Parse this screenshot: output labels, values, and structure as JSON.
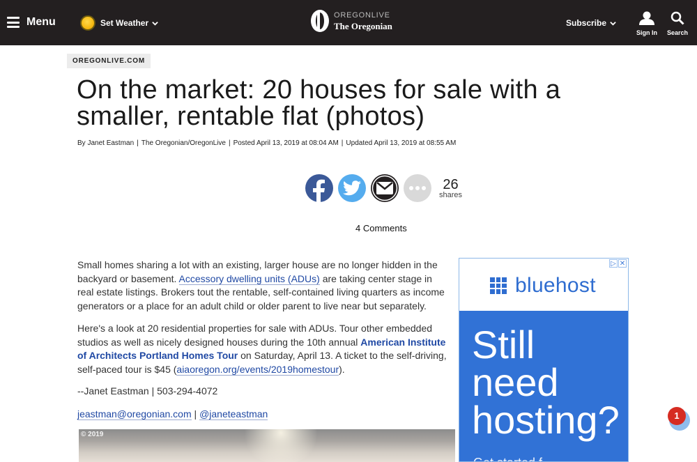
{
  "topbar": {
    "menu_label": "Menu",
    "weather_label": "Set Weather",
    "logo_top": "OREGONLIVE",
    "logo_bottom": "The Oregonian",
    "subscribe_label": "Subscribe",
    "signin_label": "Sign In",
    "search_label": "Search",
    "background_color": "#231f20"
  },
  "article": {
    "section_tag": "OREGONLIVE.COM",
    "headline": "On the market: 20 houses for sale with a smaller, rentable flat (photos)",
    "byline": {
      "prefix": "By",
      "author": "Janet Eastman",
      "publication": "The Oregonian/OregonLive",
      "posted": "Posted April 13, 2019 at 08:04 AM",
      "updated": "Updated April 13, 2019 at 08:55 AM"
    },
    "share": {
      "count": "26",
      "count_label": "shares"
    },
    "comments_label": "4 Comments",
    "paragraphs": {
      "p1_before": "Small homes sharing a lot with an existing, larger house are no longer hidden in the backyard or basement. ",
      "p1_link": "Accessory dwelling units (ADUs)",
      "p1_after": " are taking center stage in real estate listings. Brokers tout the rentable, self-contained living quarters as income generators or a place for an adult child or older parent to live near but separately.",
      "p2_before": "Here's a look at 20 residential properties for sale with ADUs. Tour other embedded studios as well as nicely designed houses during the 10th annual ",
      "p2_link": "American Institute of Architects Portland Homes Tour",
      "p2_middle": " on Saturday, April 13. A ticket to the self-driving, self-paced tour is $45 (",
      "p2_link2": "aiaoregon.org/events/2019homestour",
      "p2_after": ").",
      "p3": "--Janet Eastman | 503-294-4072",
      "p4_email": "jeastman@oregonian.com",
      "p4_sep": " | ",
      "p4_twitter": "@janeteastman"
    },
    "photo_credit": "© 2019",
    "link_color": "#2049a4"
  },
  "ad": {
    "brand": "bluehost",
    "headline": "Still need hosting?",
    "subline": "Get started f...",
    "choices_play": "▷",
    "choices_close": "✕",
    "brand_color": "#3172d6"
  },
  "notification": {
    "badge_count": "1",
    "badge_color": "#d62c22"
  }
}
